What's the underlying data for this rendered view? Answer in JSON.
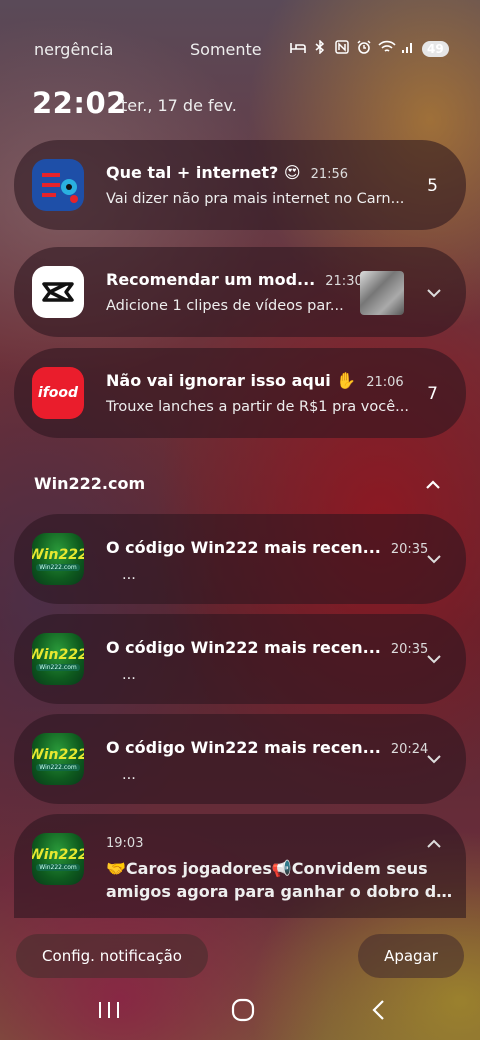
{
  "status_bar": {
    "left_text": "nergência",
    "mid_text": "Somente",
    "battery": "49"
  },
  "header": {
    "time": "22:02",
    "date": "ter., 17 de fev."
  },
  "notifications": [
    {
      "title": "Que tal + internet? 😍",
      "time": "21:56",
      "text": "Vai dizer não pra mais internet no Carn...",
      "count": "5"
    },
    {
      "title": "Recomendar um mod...",
      "time": "21:30",
      "text": "Adicione 1 clipes de vídeos par..."
    },
    {
      "title": "Não vai ignorar isso aqui ✋",
      "time": "21:06",
      "text": "Trouxe lanches a partir de R$1 pra você...",
      "count": "7"
    }
  ],
  "group": {
    "label": "Win222.com",
    "icon_text": "Win222",
    "icon_sub": "Win222.com",
    "items": [
      {
        "title": "O código Win222 mais recen...",
        "time": "20:35",
        "text": "..."
      },
      {
        "title": "O código Win222 mais recen...",
        "time": "20:35",
        "text": "..."
      },
      {
        "title": "O código Win222 mais recen...",
        "time": "20:24",
        "text": "..."
      },
      {
        "time": "19:03",
        "text_line1": "🤝Caros jogadores📢Convidem seus",
        "text_line2": "amigos agora para ganhar o dobro de rec..."
      }
    ]
  },
  "buttons": {
    "settings": "Config. notificação",
    "clear": "Apagar"
  },
  "icons": {
    "app1": "claro-icon",
    "app2": "capcut-icon",
    "app3": "ifood-icon",
    "ifood_label": "ifood",
    "ifood_color": "#ea1d2c",
    "claro_color": "#1e4fa8"
  }
}
